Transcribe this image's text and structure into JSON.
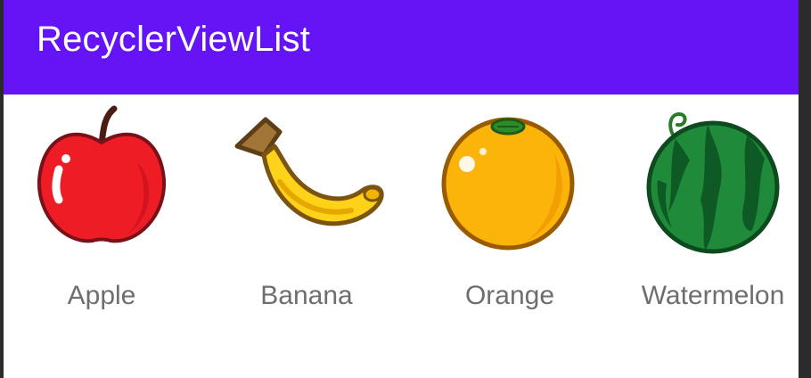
{
  "app_bar": {
    "title": "RecyclerViewList",
    "color": "#6414f5"
  },
  "fruits": [
    {
      "label": "Apple",
      "icon": "apple-icon"
    },
    {
      "label": "Banana",
      "icon": "banana-icon"
    },
    {
      "label": "Orange",
      "icon": "orange-icon"
    },
    {
      "label": "Watermelon",
      "icon": "watermelon-icon"
    }
  ]
}
